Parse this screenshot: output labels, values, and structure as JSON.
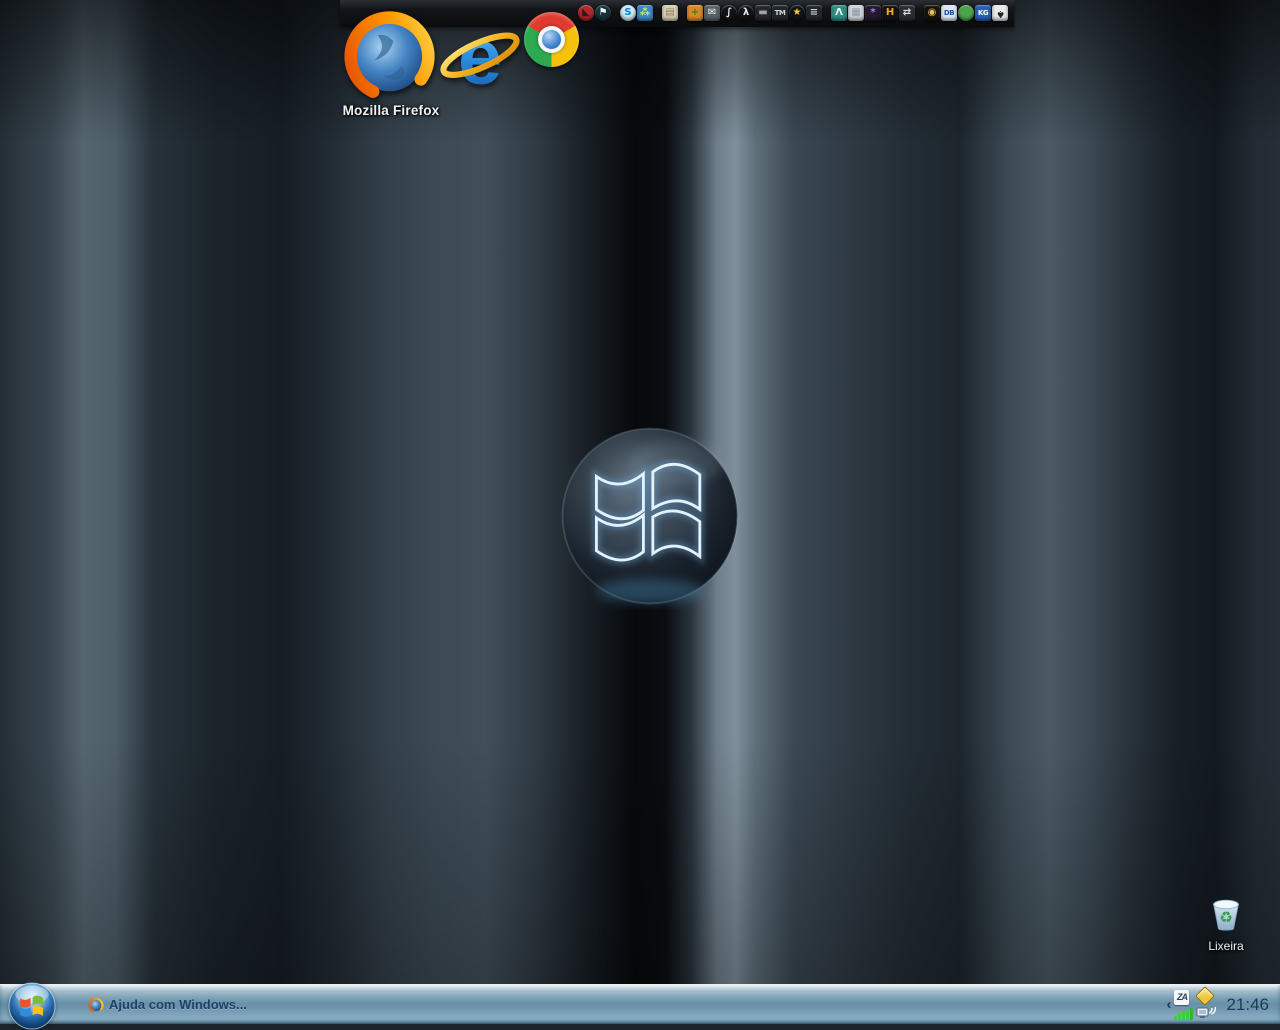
{
  "dock": {
    "hover_label": "Mozilla Firefox",
    "large_icons": [
      {
        "name": "firefox-icon"
      },
      {
        "name": "internet-explorer-icon"
      },
      {
        "name": "chrome-icon"
      }
    ],
    "small_icons": [
      {
        "name": "red-player-icon",
        "glyph": "◣",
        "bg": "#b5272c",
        "fg": "#33161a",
        "round": true
      },
      {
        "name": "globe-flag-icon",
        "glyph": "⚑",
        "bg": "#16333b",
        "fg": "#eef5f8",
        "round": true
      },
      {
        "name": "skype-icon",
        "glyph": "S",
        "bg": "#cde9f6",
        "fg": "#0087c9",
        "round": true,
        "gap": true
      },
      {
        "name": "messenger-icon",
        "glyph": "⁂",
        "bg": "#3f87c8",
        "fg": "#bfe86a"
      },
      {
        "name": "box-icon",
        "glyph": "▤",
        "bg": "#d8cdb4",
        "fg": "#8a7a5a",
        "gap": true
      },
      {
        "name": "shield-icon",
        "glyph": "+",
        "bg": "#d98a28",
        "fg": "#2f7f2f",
        "gap": true
      },
      {
        "name": "mail-icon",
        "glyph": "✉",
        "bg": "#5a6268",
        "fg": "#f0f4f6"
      },
      {
        "name": "squiggle-app-icon",
        "glyph": "∫",
        "bg": "#111418",
        "fg": "#e8ecef",
        "round": true
      },
      {
        "name": "runner-game-icon",
        "glyph": "λ",
        "bg": "#111418",
        "fg": "#e8ecef",
        "round": true
      },
      {
        "name": "vehicle-game-icon",
        "glyph": "▬",
        "bg": "#23272b",
        "fg": "#9aa4ab"
      },
      {
        "name": "tm-game-icon",
        "glyph": "TM",
        "bg": "#23272b",
        "fg": "#cfd6da",
        "small": true
      },
      {
        "name": "star-game-icon",
        "glyph": "★",
        "bg": "#101418",
        "fg": "#f5c842",
        "round": true
      },
      {
        "name": "stereo-icon",
        "glyph": "≡",
        "bg": "#23272b",
        "fg": "#cfd6da"
      },
      {
        "name": "teal-a-icon",
        "glyph": "Λ",
        "bg": "#2e8f86",
        "fg": "#f2f7f7",
        "gap": true
      },
      {
        "name": "cube-icon",
        "glyph": "▦",
        "bg": "#cfd6dc",
        "fg": "#8a95a0"
      },
      {
        "name": "purple-ball-icon",
        "glyph": "*",
        "bg": "#241a2e",
        "fg": "#b07ae8"
      },
      {
        "name": "h-app-icon",
        "glyph": "H",
        "bg": "#141414",
        "fg": "#f5a623"
      },
      {
        "name": "transfer-arrows-icon",
        "glyph": "⇄",
        "bg": "#2a2f34",
        "fg": "#d8dde2"
      },
      {
        "name": "gold-disc-icon",
        "glyph": "◉",
        "bg": "#17130d",
        "fg": "#e8c25a",
        "gap": true
      },
      {
        "name": "db-app-icon",
        "glyph": "DB",
        "bg": "#dfe8f5",
        "fg": "#1c4fa0",
        "small": true
      },
      {
        "name": "green-sphere-icon",
        "glyph": "",
        "bg": "#4aa84a",
        "fg": "#ffffff",
        "round": true
      },
      {
        "name": "kg-app-icon",
        "glyph": "KG",
        "bg": "#2b5fb8",
        "fg": "#ffffff",
        "small": true
      },
      {
        "name": "apple-icon",
        "glyph": "♠",
        "bg": "#e8eaec",
        "fg": "#222222"
      }
    ]
  },
  "desktop": {
    "recycle_bin_label": "Lixeira"
  },
  "taskbar": {
    "task": {
      "label": "Ajuda com Windows...",
      "icon": "firefox"
    },
    "tray": {
      "chevron": "‹",
      "zonealarm_text": "ZA",
      "clock": "21:46"
    }
  },
  "colors": {
    "taskbar_blue": "#6690a9",
    "task_text": "#1e4166",
    "dock_bar": "#0c0e10",
    "wallpaper_dark": "#1c252c",
    "wallpaper_light_streak": "#7f909c",
    "orb_glow_blue": "#58a8d8",
    "firefox_orange": "#ff9500",
    "ie_blue": "#2e8fe0",
    "ie_gold": "#f5b31a"
  }
}
